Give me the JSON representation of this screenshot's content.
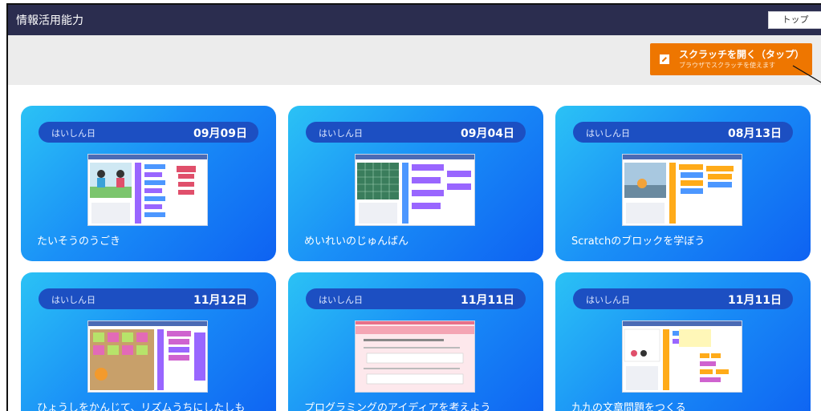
{
  "header": {
    "title": "情報活用能力",
    "top_button_label": "トップ"
  },
  "scratch_button": {
    "label": "スクラッチを開く（タップ）",
    "sublabel": "ブラウザでスクラッチを使えます",
    "icon": "edit-icon"
  },
  "colors": {
    "header_bg": "#2b2d4f",
    "accent_orange": "#ee7600",
    "card_gradient_start": "#2bc2f5",
    "card_gradient_end": "#0e62f2",
    "pill_bg": "#1c4fc2"
  },
  "cards": [
    {
      "label": "はいしん日",
      "date": "09月09日",
      "title": "たいそうのうごき",
      "thumbnail": "scratch-editor-two-characters"
    },
    {
      "label": "はいしん日",
      "date": "09月04日",
      "title": "めいれいのじゅんばん",
      "thumbnail": "scratch-editor-grid-stage"
    },
    {
      "label": "はいしん日",
      "date": "08月13日",
      "title": "Scratchのブロックを学ぼう",
      "thumbnail": "scratch-editor-cat-stage"
    },
    {
      "label": "はいしん日",
      "date": "11月12日",
      "title": "ひょうしをかんじて、リズムうちにしたしも",
      "thumbnail": "scratch-editor-rhythm"
    },
    {
      "label": "はいしん日",
      "date": "11月11日",
      "title": "プログラミングのアイディアを考えよう",
      "thumbnail": "worksheet-pink"
    },
    {
      "label": "はいしん日",
      "date": "11月11日",
      "title": "九九の文章問題をつくる",
      "thumbnail": "scratch-editor-multiplication"
    }
  ]
}
